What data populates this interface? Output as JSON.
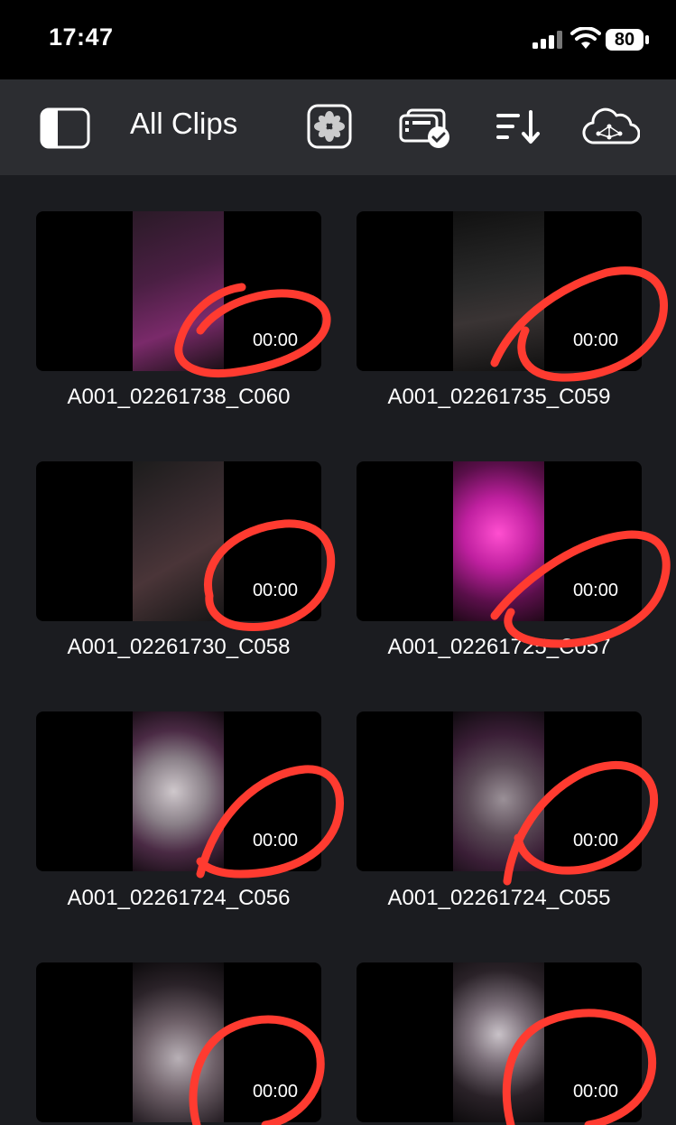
{
  "status": {
    "time": "17:47",
    "battery": "80"
  },
  "toolbar": {
    "title": "All Clips",
    "icons": [
      "sidebar-toggle-icon",
      "photos-icon",
      "media-select-icon",
      "sort-icon",
      "cloud-network-icon"
    ]
  },
  "clips": [
    {
      "name": "A001_02261738_C060",
      "duration": "00:00"
    },
    {
      "name": "A001_02261735_C059",
      "duration": "00:00"
    },
    {
      "name": "A001_02261730_C058",
      "duration": "00:00"
    },
    {
      "name": "A001_02261725_C057",
      "duration": "00:00"
    },
    {
      "name": "A001_02261724_C056",
      "duration": "00:00"
    },
    {
      "name": "A001_02261724_C055",
      "duration": "00:00"
    },
    {
      "name": "",
      "duration": "00:00"
    },
    {
      "name": "",
      "duration": "00:00"
    }
  ],
  "colors": {
    "annotation": "#ff3b30",
    "accent": "#ff2fb8"
  }
}
